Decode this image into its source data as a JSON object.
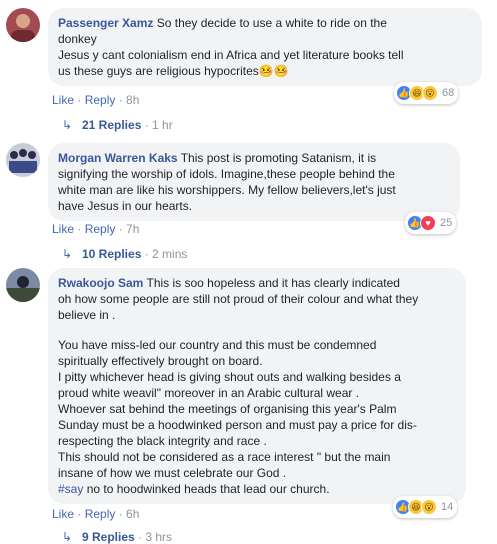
{
  "comments": [
    {
      "author": "Passenger Xamz",
      "text_lines": [
        "So they decide to use a white to ride on the",
        "donkey",
        "Jesus y cant colonialism end in Africa and yet literature books tell",
        "us these guys are religious hypocrites🤒🤒"
      ],
      "actions": {
        "like": "Like",
        "reply": "Reply",
        "time": "8h"
      },
      "reaction_count": "68",
      "replies": {
        "label": "21 Replies",
        "time": "1 hr"
      }
    },
    {
      "author": "Morgan Warren Kaks",
      "text_lines": [
        "This post is promoting Satanism, it is",
        "signifying the worship of idols. Imagine,these people behind the",
        "white man are like his worshippers. My fellow believers,let's just",
        "have Jesus in our hearts."
      ],
      "actions": {
        "like": "Like",
        "reply": "Reply",
        "time": "7h"
      },
      "reaction_count": "25",
      "replies": {
        "label": "10 Replies",
        "time": "2 mins"
      }
    },
    {
      "author": "Rwakoojo Sam",
      "text_lines": [
        "This is soo hopeless and it has clearly indicated",
        "oh how some people are still not proud of their colour and what they",
        "believe in ."
      ],
      "text_lines_2": [
        "You have miss-led our country and this must be condemned",
        "spiritually effectively brought on board.",
        "I pitty whichever head is giving shout outs and walking besides a",
        "proud white weavil\" moreover in an Arabic cultural wear .",
        "Whoever sat behind the meetings of organising this year's Palm",
        "Sunday must be a hoodwinked person and must pay a price for dis-",
        "respecting the black integrity and race .",
        "This should not be considered as a race interest \" but the main",
        "insane of how we must celebrate our God ."
      ],
      "hashtag": "#say",
      "last_line": " no to hoodwinked heads that lead our church.",
      "actions": {
        "like": "Like",
        "reply": "Reply",
        "time": "6h"
      },
      "reaction_count": "14",
      "replies": {
        "label": "9 Replies",
        "time": "3 hrs"
      }
    }
  ],
  "separator": " · ",
  "icons": {
    "reply_arrow": "reply-arrow-icon"
  }
}
